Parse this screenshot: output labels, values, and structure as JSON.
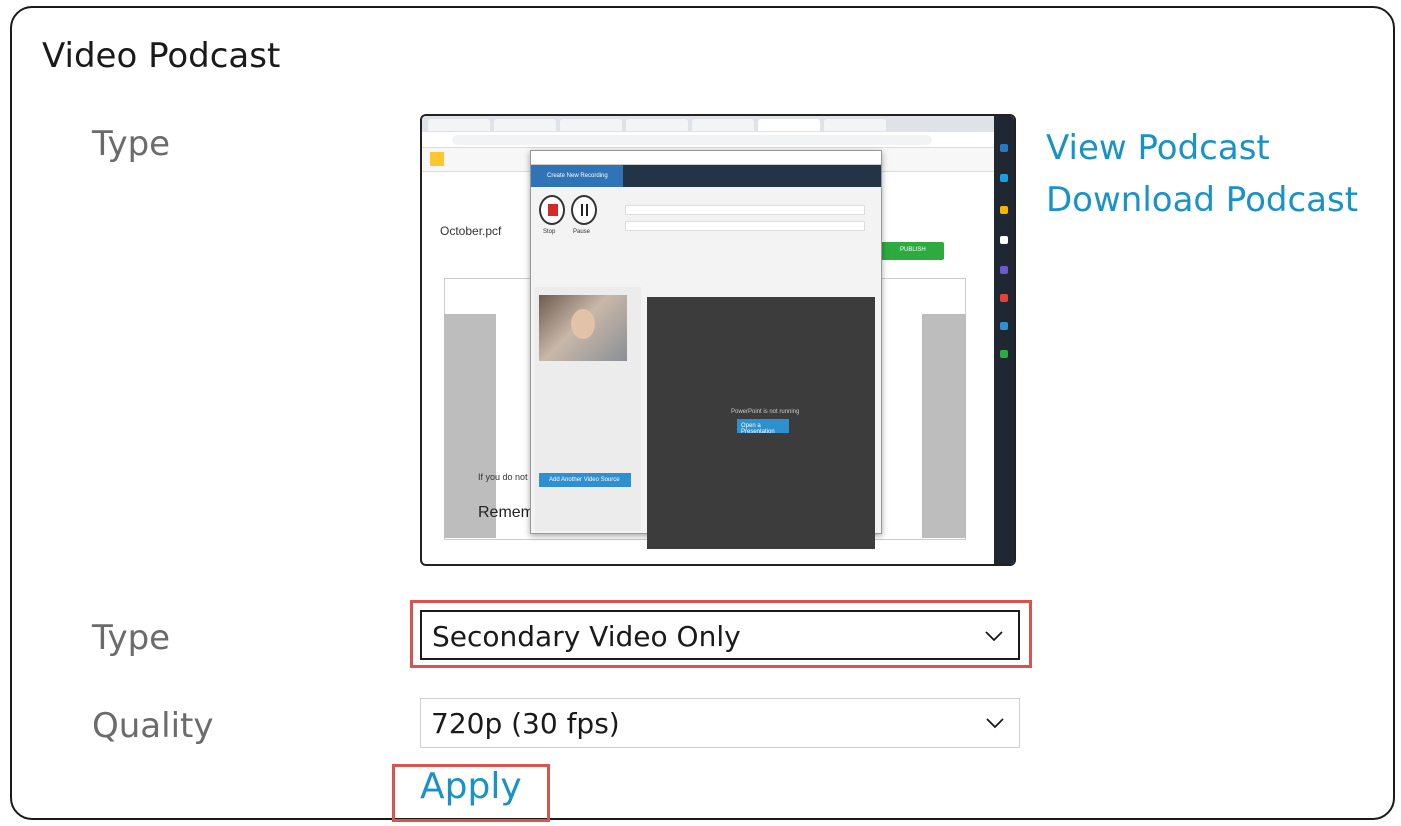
{
  "panel": {
    "title": "Video Podcast",
    "type_label": "Type",
    "links": {
      "view": "View Podcast",
      "download": "Download Podcast"
    }
  },
  "form": {
    "type_label": "Type",
    "type_value": "Secondary Video Only",
    "quality_label": "Quality",
    "quality_value": "720p (30 fps)",
    "apply_label": "Apply"
  },
  "preview": {
    "page_title": "October.pcf",
    "nav_selected": "Create New Recording",
    "stop_label": "Stop",
    "pause_label": "Pause",
    "dark_message": "PowerPoint is not running",
    "open_button": "Open a Presentation",
    "add_source": "Add Another Video Source",
    "editor_text": "If you do not want y Primary Sources. Fr",
    "editor_heading": "Rememb",
    "publish_label": "PUBLISH"
  },
  "colors": {
    "link": "#1892c8",
    "highlight": "#d9534f",
    "label": "#6b6b6b"
  }
}
